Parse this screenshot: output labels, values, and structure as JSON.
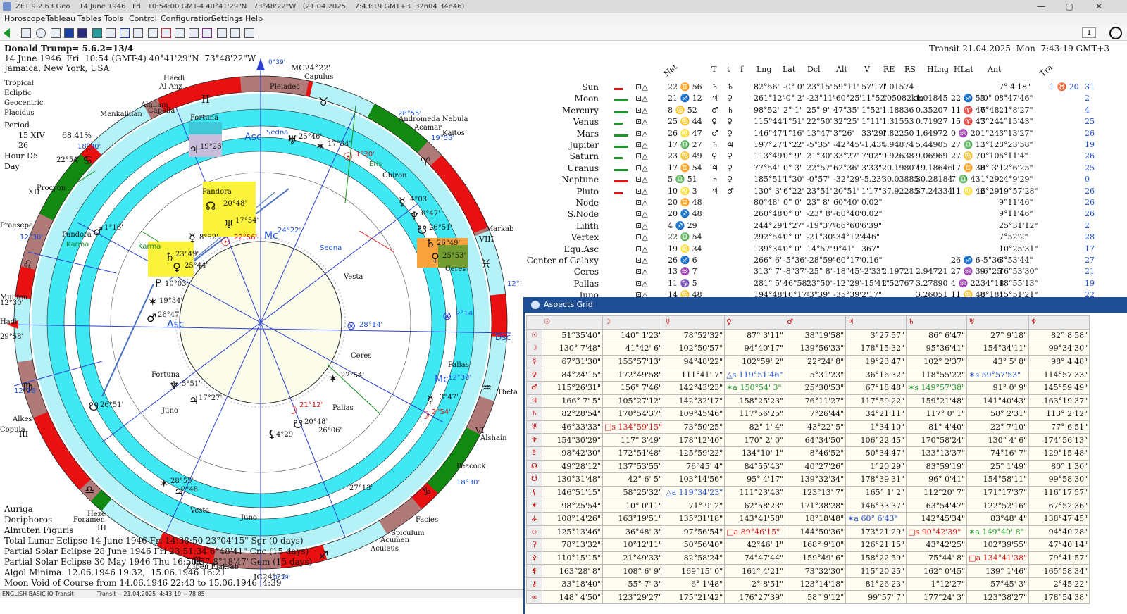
{
  "window": {
    "title": "ZET 9.2.63 Geo    14 June 1946   Fri   10:54:00 GMT-4 40°41'29\"N   73°48'22\"W   (21.04.2025    7:43:19 GMT+3  32n04 34e46)",
    "minimize": "—",
    "maximize": "▢",
    "close": "✕"
  },
  "menu": [
    "Horoscope",
    "Tableau",
    "Tables",
    "Tools",
    "Control",
    "Configuration",
    "Settings",
    "Help"
  ],
  "toolbar": {
    "spin_value": "1"
  },
  "natal": {
    "name_line": "Donald Trump= 5.6.2=13/4",
    "date_line": "14 June 1946  Fri  10:54 (GMT-4) 40°41'29\"N  73°48'22\"W",
    "place_line": "Jamaica, New York, USA",
    "settings": [
      "Tropical",
      "Ecliptic",
      "Geocentric",
      "Placidus"
    ],
    "period_label": "Period",
    "period_value": "15 XIV",
    "period_pct": "68.41%",
    "number_26": "26",
    "hour_label": "Hour D5",
    "day_label": "Day"
  },
  "transit_header": "Transit 21.04.2025  Mon  7:43:19 GMT+3",
  "bottom_notes": [
    "Auriga",
    "Doriphoros",
    "Almuten Figuris",
    "Total Lunar Eclipse 14 June 1946 Fri 14:38:50 23°04'15\" Sgr (0 days)",
    "Partial Solar Eclipse 28 June 1946 Fri 23:51:34 6°48'41\" Cnc (15 days)",
    "Partial Solar Eclipse 30 May 1946 Thu 16:50:57 8°18'47\"Gem (15 days)",
    "Algol Minima: 12.06.1946 19:32,  15.06.1946 16:21",
    "Moon Void of Course from 14.06.1946 22:43 to 15.06.1946  4:39"
  ],
  "status": {
    "language": "ENGLISH-BASIC",
    "io": "IO Transit",
    "transit": "Transit -- 21.04.2025  4:43:19 -- 78.85"
  },
  "chart_labels": {
    "mc_top": "MC24°22'",
    "mc_top_small": "0°39'",
    "ic_bottom": "IC24°22'",
    "ic_bottom_small": "0°39'",
    "asc": "Asc",
    "dsc": "Dsc",
    "mc_inner": "Mc",
    "asc_inner_deg": "24°22'",
    "deg_28_55": "28°55'",
    "deg_19_55": "19°55'",
    "deg_18_30_a": "18°30'",
    "deg_18_30_b": "18°30'",
    "deg_12_30_a": "12°30'",
    "deg_12_16_a": "12°16'",
    "deg_12_16_b": "12°16'",
    "deg_29_58": "29°58'",
    "deg_22_54_a": "22°54'",
    "stars": [
      "Capulus",
      "Pleiades",
      "Haedi",
      "Al Anz",
      "Alnilam",
      "Capella",
      "Menkalinan",
      "Procyon",
      "Praesepe",
      "Andromeda Nebula",
      "Acamar",
      "Kaitos",
      "Chiron",
      "Eris",
      "Markab",
      "Theta",
      "Alshain",
      "Peacock",
      "Facies",
      "Spiculum",
      "Acumen",
      "Aculeus",
      "Zuben Elakrab",
      "Heze",
      "Foramen",
      "Alkes",
      "Copula",
      "Hadi",
      "Mulifen",
      "Sedna",
      "Vesta",
      "Juno",
      "Pallas",
      "Ceres",
      "Fortuna",
      "Pandora",
      "Karma"
    ],
    "planet_labels": [
      "25°46'",
      "17°34'",
      "1°20'",
      "19°28'",
      "20°48'",
      "17°54'",
      "22°56'",
      "8°52'",
      "23°49'",
      "25°44'",
      "10°03'",
      "19°34'",
      "26°47'",
      "1°16'",
      "4°03'",
      "0°47'",
      "26°51'",
      "26°49'",
      "25°53'",
      "2°14'",
      "28°14'",
      "12°39'",
      "3°47'",
      "2°54'",
      "22°54'",
      "21°12'",
      "20°48'",
      "26°06'",
      "4°29'",
      "5°51'",
      "17°27'",
      "26°51'",
      "28°55'",
      "2°48'",
      "27°13'",
      "24°22'",
      "12°30'"
    ],
    "house_numbers": [
      "II",
      "III",
      "V",
      "VI",
      "VIII",
      "IX",
      "XI",
      "XII"
    ]
  },
  "planet_table": {
    "header": [
      "Nat",
      "T",
      "t",
      "f",
      "Lng",
      "Lat",
      "Dcl",
      "Alt",
      "V",
      "RE",
      "RS",
      "HLng",
      "HLat",
      "Ant",
      "Tra"
    ],
    "rows": [
      {
        "name": "Sun",
        "pos": "22 ♊ 56",
        "c1": "♄",
        "c2": "♄",
        "lng": "82°56'",
        "lat": "-0° 0'",
        "dcl": "23°15'",
        "alt": "59°11'",
        "v": "57'17\"",
        "re": "1.01574",
        "rs": "",
        "hlng": "",
        "hlat": "",
        "ant": "7° 4'18\"",
        "tra": "1 ♉ 20",
        "last": "31"
      },
      {
        "name": "Moon",
        "pos": "21 ♐ 12",
        "c1": "♃",
        "c2": "♀",
        "lng": "261°12'",
        "lat": "-0° 2'",
        "dcl": "-23°11'",
        "alt": "-60°25'",
        "v": "11°52'",
        "re": "405082km",
        "rs": "1.01845",
        "hlng": "22 ♐ 55",
        "hlat": "-0° 0'",
        "ant": "8°47'46\"",
        "tra": "",
        "last": "2"
      },
      {
        "name": "Mercury",
        "pos": "8 ♋ 52",
        "c1": "♂",
        "c2": "♄",
        "lng": "98°52'",
        "lat": "2° 1'",
        "dcl": "25° 9'",
        "alt": "47°35'",
        "v": "1°52'",
        "re": "1.18836",
        "rs": "0.35207",
        "hlng": "11 ♈ 47",
        "hlat": "6°48'",
        "ant": "21°8'27\"",
        "tra": "",
        "last": "4"
      },
      {
        "name": "Venus",
        "pos": "25 ♋ 44",
        "c1": "♀",
        "c2": "♀",
        "lng": "115°44'",
        "lat": "1°51'",
        "dcl": "22°50'",
        "alt": "32°25'",
        "v": "1°11'",
        "re": "1.31553",
        "rs": "0.71927",
        "hlng": "15 ♈ 47",
        "hlat": "3°24'",
        "ant": "4°15'43\"",
        "tra": "",
        "last": "25"
      },
      {
        "name": "Mars",
        "pos": "26 ♌ 47",
        "c1": "♂",
        "c2": "♀",
        "lng": "146°47'",
        "lat": "1°16'",
        "dcl": "13°47'",
        "alt": "3°26'",
        "v": "33'29\"",
        "re": "1.82250",
        "rs": "1.64972",
        "hlng": "0 ♒ 20",
        "hlat": "1°24'",
        "ant": "3°13'27\"",
        "tra": "",
        "last": "26"
      },
      {
        "name": "Jupiter",
        "pos": "17 ♎ 27",
        "c1": "♄",
        "c2": "♃",
        "lng": "197°27'",
        "lat": "1°22'",
        "dcl": "-5°35'",
        "alt": "-42°45'",
        "v": "-1.43'",
        "re": "4.94874",
        "rs": "5.44905",
        "hlng": "27 ♎ 13",
        "hlat": "1°12'",
        "ant": "3°23'58\"",
        "tra": "",
        "last": "19"
      },
      {
        "name": "Saturn",
        "pos": "23 ♋ 49",
        "c1": "♀",
        "c2": "♀",
        "lng": "113°49'",
        "lat": "0° 9'",
        "dcl": "21°30'",
        "alt": "33°27'",
        "v": "7'02\"",
        "re": "9.92638",
        "rs": "9.06969",
        "hlng": "27 ♋ 7",
        "hlat": "0°10'",
        "ant": "6°11'4\"",
        "tra": "",
        "last": "26"
      },
      {
        "name": "Uranus",
        "pos": "17 ♊ 54",
        "c1": "♃",
        "c2": "♀",
        "lng": "77°54'",
        "lat": "0° 3'",
        "dcl": "22°57'",
        "alt": "62°36'",
        "v": "3'33\"",
        "re": "20.19807",
        "rs": "19.18646",
        "hlng": "17 ♊ 38",
        "hlat": "0° 3'",
        "ant": "12°6'25\"",
        "tra": "",
        "last": "25"
      },
      {
        "name": "Neptune",
        "pos": "5 ♎ 51",
        "c1": "♄",
        "c2": "♀",
        "lng": "185°51'",
        "lat": "1°30'",
        "dcl": "-0°57'",
        "alt": "-32°29'",
        "v": "-5.23'",
        "re": "30.03885",
        "rs": "30.28184",
        "hlng": "7 ♎ 43",
        "hlat": "1°29'",
        "ant": "24°9'29\"",
        "tra": "",
        "last": "0"
      },
      {
        "name": "Pluto",
        "pos": "10 ♌ 3",
        "c1": "♃",
        "c2": "♂",
        "lng": "130° 3'",
        "lat": "6°22'",
        "dcl": "23°51'",
        "alt": "20°51'",
        "v": "1'17\"",
        "re": "37.92285",
        "rs": "37.24334",
        "hlng": "11 ♌ 42",
        "hlat": "6°29'",
        "ant": "19°57'28\"",
        "tra": "",
        "last": "26"
      },
      {
        "name": "Node",
        "pos": "20 ♊ 48",
        "c1": "",
        "c2": "",
        "lng": "80°48'",
        "lat": "0° 0'",
        "dcl": "23° 8'",
        "alt": "60°40'",
        "v": "0.02\"",
        "re": "",
        "rs": "",
        "hlng": "",
        "hlat": "",
        "ant": "9°11'46\"",
        "tra": "",
        "last": "26"
      },
      {
        "name": "S.Node",
        "pos": "20 ♐ 48",
        "c1": "",
        "c2": "",
        "lng": "260°48'",
        "lat": "0° 0'",
        "dcl": "-23° 8'",
        "alt": "-60°40'",
        "v": "0.02\"",
        "re": "",
        "rs": "",
        "hlng": "",
        "hlat": "",
        "ant": "9°11'46\"",
        "tra": "",
        "last": "26"
      },
      {
        "name": "Lilith",
        "pos": "4 ♐ 29",
        "c1": "",
        "c2": "",
        "lng": "244°29'",
        "lat": "1°27'",
        "dcl": "-19°37'",
        "alt": "-66°60'",
        "v": "6'39\"",
        "re": "",
        "rs": "",
        "hlng": "",
        "hlat": "",
        "ant": "25°31'12\"",
        "tra": "",
        "last": "2"
      },
      {
        "name": "Vertex",
        "pos": "22 ♎ 54",
        "c1": "",
        "c2": "",
        "lng": "292°54'",
        "lat": "0° 0'",
        "dcl": "-21°30'",
        "alt": "-34°12'",
        "v": "446\"",
        "re": "",
        "rs": "",
        "hlng": "",
        "hlat": "",
        "ant": "7°52'2\"",
        "tra": "",
        "last": "28"
      },
      {
        "name": "Equ.Asc",
        "pos": "19 ♌ 34",
        "c1": "",
        "c2": "",
        "lng": "139°34'",
        "lat": "0° 0'",
        "dcl": "14°57'",
        "alt": "9°41'",
        "v": "367\"",
        "re": "",
        "rs": "",
        "hlng": "",
        "hlat": "",
        "ant": "10°25'31\"",
        "tra": "",
        "last": "17"
      },
      {
        "name": "Center of Galaxy",
        "pos": "26 ♐ 6",
        "c1": "",
        "c2": "",
        "lng": "266° 6'",
        "lat": "-5°36'",
        "dcl": "-28°59'",
        "alt": "-60°17'",
        "v": "0.16\"",
        "re": "",
        "rs": "",
        "hlng": "26 ♐ 6",
        "hlat": "-5°36'",
        "ant": "3°53'44\"",
        "tra": "",
        "last": "27"
      },
      {
        "name": "Ceres",
        "pos": "13 ♒ 7",
        "c1": "",
        "c2": "",
        "lng": "313° 7'",
        "lat": "-8°37'",
        "dcl": "-25° 8'",
        "alt": "-18°45'",
        "v": "-2'33\"",
        "re": "2.19721",
        "rs": "2.94721",
        "hlng": "27 ♒ 39",
        "hlat": "-6°25'",
        "ant": "16°53'30\"",
        "tra": "",
        "last": "21"
      },
      {
        "name": "Pallas",
        "pos": "11 ♑ 5",
        "c1": "",
        "c2": "",
        "lng": "281° 5'",
        "lat": "46°58'",
        "dcl": "23°50'",
        "alt": "-12°29'",
        "v": "-15'41\"",
        "re": "2.52767",
        "rs": "3.27890",
        "hlng": "4 ♒ 22",
        "hlat": "34°18'",
        "ant": "18°55'13\"",
        "tra": "",
        "last": "19"
      },
      {
        "name": "Juno",
        "pos": "14 ♋ 48",
        "c1": "",
        "c2": "",
        "lng": "194°48'",
        "lat": "10°17'",
        "dcl": "-3°39'",
        "alt": "-35°39'",
        "v": "2'17\"",
        "re": "",
        "rs": "3.26051",
        "hlng": "11 ♋ 48",
        "hlat": "8°18'",
        "ant": "15°51'21\"",
        "tra": "",
        "last": "22"
      }
    ]
  },
  "aspects": {
    "title": "Aspects Grid",
    "col_headers": [
      "☉",
      "☽",
      "☿",
      "♀",
      "♂",
      "♃",
      "♄",
      "♅",
      "♆",
      "♇"
    ],
    "row_headers": [
      "☉",
      "☽",
      "☿",
      "♀",
      "♂",
      "♃",
      "♄",
      "♅",
      "♆",
      "♇",
      "☊",
      "☋",
      "⚸",
      "✶",
      "⚶",
      "◇",
      "⚳",
      "⚴",
      "⚵",
      "⚷",
      "∞"
    ],
    "rows": [
      [
        "51°35'40\"",
        "140° 1'23\"",
        "78°52'32\"",
        "87° 3'11\"",
        "38°19'58\"",
        "3°27'57\"",
        "86° 6'47\"",
        "27° 9'18\"",
        "82° 8'58\""
      ],
      [
        "130° 7'48\"",
        "41°42' 6\"",
        "102°50'57\"",
        "94°40'17\"",
        "139°56'33\"",
        "178°15'32\"",
        "95°36'41\"",
        "154°34'11\"",
        "99°34'30\""
      ],
      [
        "67°31'30\"",
        "155°57'13\"",
        "94°48'22\"",
        "102°59' 2\"",
        "22°24' 8\"",
        "19°23'47\"",
        "102° 2'37\"",
        "43° 5' 8\"",
        "98° 4'48\""
      ],
      [
        "84°24'15\"",
        "172°49'58\"",
        "111°41' 7\"",
        "△s 119°51'46\"",
        "5°31'23\"",
        "36°16'32\"",
        "118°55'22\"",
        "✶s 59°57'53\"",
        "114°57'33\""
      ],
      [
        "115°26'31\"",
        "156° 7'46\"",
        "142°43'23\"",
        "✶a 150°54' 3\"",
        "25°30'53\"",
        "67°18'48\"",
        "✶s 149°57'38\"",
        "91° 0' 9\"",
        "145°59'49\""
      ],
      [
        "166° 7' 5\"",
        "105°27'12\"",
        "142°32'17\"",
        "158°25'23\"",
        "76°11'27\"",
        "117°59'22\"",
        "159°21'48\"",
        "141°40'43\"",
        "163°19'37\""
      ],
      [
        "82°28'54\"",
        "170°54'37\"",
        "109°45'46\"",
        "117°56'25\"",
        "7°26'44\"",
        "34°21'11\"",
        "117° 0' 1\"",
        "58° 2'31\"",
        "113° 2'12\""
      ],
      [
        "46°33'33\"",
        "□s 134°59'15\"",
        "73°50'25\"",
        "82° 1' 4\"",
        "43°22' 5\"",
        "1°34'10\"",
        "81° 4'40\"",
        "22° 7'10\"",
        "77° 6'51\""
      ],
      [
        "154°30'29\"",
        "117° 3'49\"",
        "178°12'40\"",
        "170° 2' 0\"",
        "64°34'50\"",
        "106°22'45\"",
        "170°58'24\"",
        "130° 4' 6\"",
        "174°56'13\""
      ],
      [
        "98°42'30\"",
        "172°51'48\"",
        "125°59'22\"",
        "134°10' 1\"",
        "8°46'52\"",
        "50°34'47\"",
        "133°13'37\"",
        "74°16' 7\"",
        "129°15'48\""
      ],
      [
        "49°28'12\"",
        "137°53'55\"",
        "76°45' 4\"",
        "84°55'43\"",
        "40°27'26\"",
        "1°20'29\"",
        "83°59'19\"",
        "25° 1'49\"",
        "80° 1'30\""
      ],
      [
        "130°31'48\"",
        "42° 6' 5\"",
        "103°14'56\"",
        "95° 4'17\"",
        "139°32'34\"",
        "178°39'31\"",
        "96° 0'41\"",
        "154°58'11\"",
        "99°58'30\""
      ],
      [
        "146°51'15\"",
        "58°25'32\"",
        "△a 119°34'23\"",
        "111°23'43\"",
        "123°13' 7\"",
        "165° 1' 2\"",
        "112°20' 7\"",
        "171°17'37\"",
        "116°17'57\""
      ],
      [
        "98°25'54\"",
        "10° 0'11\"",
        "71° 9' 2\"",
        "62°58'23\"",
        "171°38'28\"",
        "146°33'37\"",
        "63°54'47\"",
        "122°52'16\"",
        "67°52'36\""
      ],
      [
        "108°14'26\"",
        "163°19'51\"",
        "135°31'18\"",
        "143°41'58\"",
        "18°18'48\"",
        "✶a 60° 6'43\"",
        "142°45'34\"",
        "83°48' 4\"",
        "138°47'45\""
      ],
      [
        "125°13'46\"",
        "36°48' 3\"",
        "97°56'54\"",
        "□a 89°46'15\"",
        "144°50'36\"",
        "173°21'29\"",
        "□s 90°42'39\"",
        "✶a 149°40' 8\"",
        "94°40'28\""
      ],
      [
        "78°13'32\"",
        "10°12'11\"",
        "50°56'40\"",
        "42°46' 1\"",
        "168° 9'10\"",
        "126°21'15\"",
        "43°42'25\"",
        "102°39'55\"",
        "47°40'14\""
      ],
      [
        "110°15'15\"",
        "21°49'33\"",
        "82°58'24\"",
        "74°47'44\"",
        "159°49' 6\"",
        "158°22'59\"",
        "75°44' 8\"",
        "□a 134°41'38\"",
        "79°41'57\""
      ],
      [
        "163°28' 8\"",
        "108° 6' 9\"",
        "169°15' 0\"",
        "161° 4'21\"",
        "73°32'30\"",
        "115°20'25\"",
        "162° 0'45\"",
        "139° 1'46\"",
        "165°58'34\""
      ],
      [
        "33°18'40\"",
        "55° 7' 3\"",
        "6° 1'48\"",
        "2° 8'51\"",
        "123°14'18\"",
        "81°26'23\"",
        "1°12'27\"",
        "57°45' 3\"",
        "2°45'22\""
      ],
      [
        "148° 4'50\"",
        "123°29'27\"",
        "175°21'42\"",
        "176°27'39\"",
        "58° 9'12\"",
        "99°57' 7\"",
        "177°24' 3\"",
        "123°38'27\"",
        "178°54'38\""
      ]
    ]
  },
  "colors": {
    "cyan": "#3fe8f2",
    "light_cyan": "#b4f2f8",
    "red": "#e81010",
    "green": "#128a12",
    "rose": "#b07a78",
    "title_blue": "#1e4f96",
    "highlight_yellow": "#fbf23c",
    "highlight_orange": "#f7a23c"
  }
}
